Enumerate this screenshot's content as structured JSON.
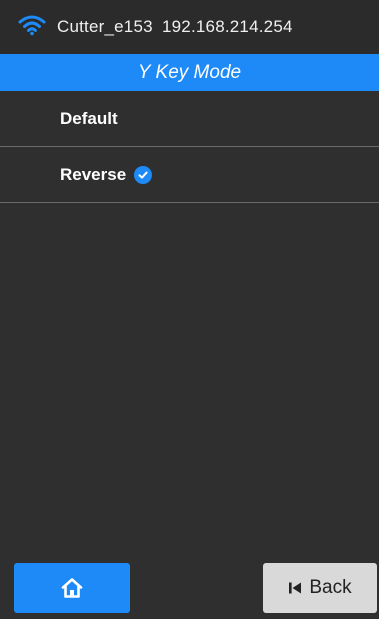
{
  "status": {
    "device_name": "Cutter_e153",
    "ip_address": "192.168.214.254",
    "wifi_icon": "wifi-icon"
  },
  "header": {
    "title": "Y Key Mode"
  },
  "options": [
    {
      "label": "Default",
      "selected": false
    },
    {
      "label": "Reverse",
      "selected": true
    }
  ],
  "footer": {
    "home_icon": "home-icon",
    "back_label": "Back",
    "back_icon": "skip-previous-icon"
  },
  "colors": {
    "accent": "#1e8af8",
    "background": "#2f2f2f",
    "status_bar": "#2b2b2b",
    "back_button": "#d9d9d9"
  }
}
